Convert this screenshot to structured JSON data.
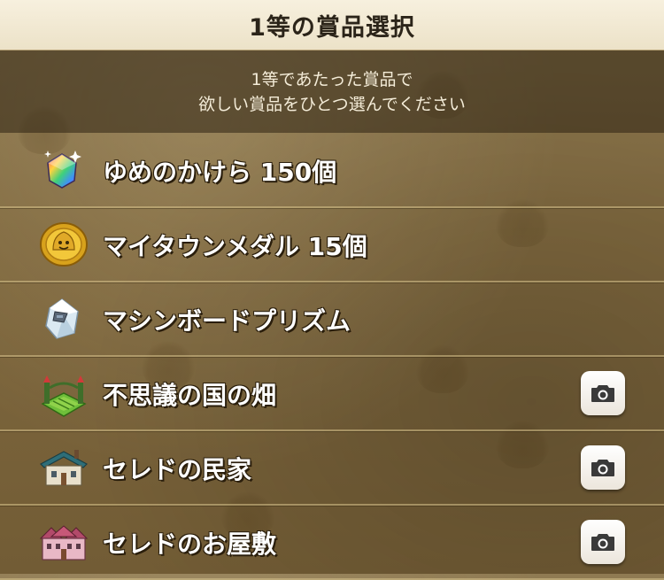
{
  "header": {
    "title": "1等の賞品選択"
  },
  "instructions": {
    "line1": "1等であたった賞品で",
    "line2": "欲しい賞品をひとつ選んでください"
  },
  "prizes": [
    {
      "label": "ゆめのかけら 150個",
      "icon": "dream-shard-icon",
      "has_preview": false
    },
    {
      "label": "マイタウンメダル 15個",
      "icon": "mytown-medal-icon",
      "has_preview": false
    },
    {
      "label": "マシンボードプリズム",
      "icon": "machine-board-prism-icon",
      "has_preview": false
    },
    {
      "label": "不思議の国の畑",
      "icon": "wonderland-field-icon",
      "has_preview": true
    },
    {
      "label": "セレドの民家",
      "icon": "seredo-house-icon",
      "has_preview": true
    },
    {
      "label": "セレドのお屋敷",
      "icon": "seredo-mansion-icon",
      "has_preview": true
    }
  ],
  "colors": {
    "header_bg": "#f4ecd8",
    "panel_bg": "#80693f",
    "label_text": "#ffffff"
  }
}
